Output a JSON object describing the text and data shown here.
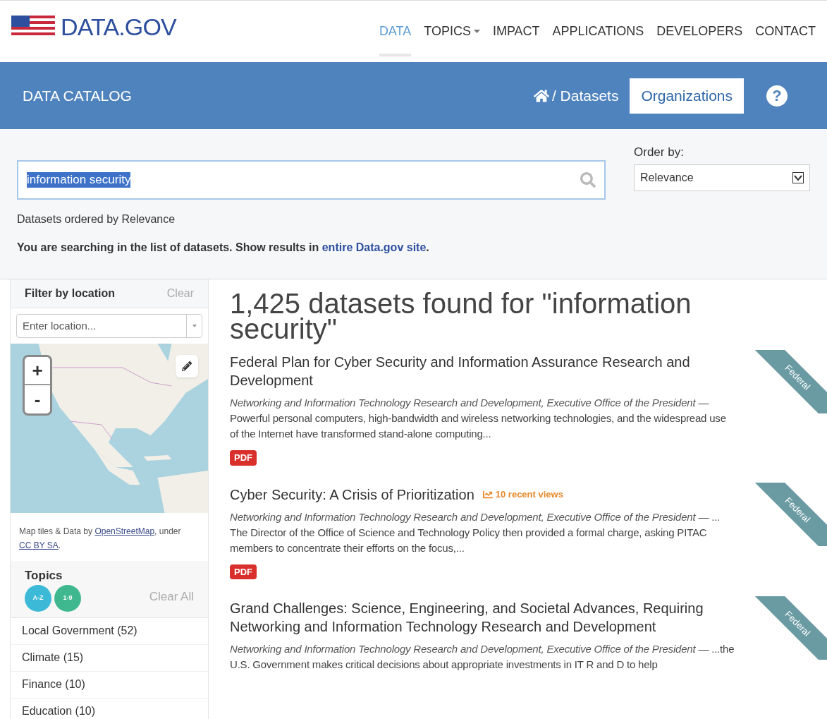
{
  "header": {
    "logo": "DATA.GOV",
    "nav": [
      {
        "label": "DATA",
        "selected": true,
        "dropdown": false
      },
      {
        "label": "TOPICS",
        "selected": false,
        "dropdown": true
      },
      {
        "label": "IMPACT",
        "selected": false,
        "dropdown": false
      },
      {
        "label": "APPLICATIONS",
        "selected": false,
        "dropdown": false
      },
      {
        "label": "DEVELOPERS",
        "selected": false,
        "dropdown": false
      },
      {
        "label": "CONTACT",
        "selected": false,
        "dropdown": false
      }
    ]
  },
  "catalog_bar": {
    "title": "DATA CATALOG",
    "breadcrumb": "/ Datasets",
    "organizations_button": "Organizations",
    "help": "?"
  },
  "search": {
    "value": "information security",
    "order_label": "Order by:",
    "order_value": "Relevance",
    "ordered_note": "Datasets ordered by Relevance",
    "scope_note": "You are searching in the list of datasets. Show results in ",
    "scope_link": "entire Data.gov site",
    "scope_end": "."
  },
  "sidebar": {
    "location_title": "Filter by location",
    "location_clear": "Clear",
    "location_placeholder": "Enter location...",
    "zoom_in": "+",
    "zoom_out": "-",
    "map_credit_prefix": "Map tiles & Data by ",
    "map_credit_link": "OpenStreetMap",
    "map_credit_mid": ", under ",
    "map_credit_license": "CC BY SA",
    "map_credit_end": ".",
    "topics_title": "Topics",
    "sort_buttons": [
      {
        "label": "A-Z",
        "color": "#3bb9d6"
      },
      {
        "label": "1-9",
        "color": "#3fb88f"
      }
    ],
    "topics_clear": "Clear All",
    "topics": [
      "Local Government (52)",
      "Climate (15)",
      "Finance (10)",
      "Education (10)"
    ]
  },
  "results": {
    "heading": "1,425 datasets found for \"information security\"",
    "items": [
      {
        "title": "Federal Plan for Cyber Security and Information Assurance Research and Development",
        "organization": "Networking and Information Technology Research and Development, Executive Office of the President",
        "description": "— Powerful personal computers, high-bandwidth and wireless networking technologies, and the widespread use of the Internet have transformed stand-alone computing...",
        "formats": [
          "PDF"
        ],
        "ribbon": "Federal"
      },
      {
        "title": "Cyber Security: A Crisis of Prioritization",
        "views": "10 recent views",
        "organization": "Networking and Information Technology Research and Development, Executive Office of the President",
        "description": "— ... The Director of the Office of Science and Technology Policy then provided a formal charge, asking PITAC members to concentrate their efforts on the focus,...",
        "formats": [
          "PDF"
        ],
        "ribbon": "Federal"
      },
      {
        "title": "Grand Challenges: Science, Engineering, and Societal Advances, Requiring Networking and Information Technology Research and Development",
        "organization": "Networking and Information Technology Research and Development, Executive Office of the President",
        "description": "— ...the U.S. Government makes critical decisions about appropriate investments in IT R and D to help",
        "ribbon": "Federal"
      }
    ]
  }
}
